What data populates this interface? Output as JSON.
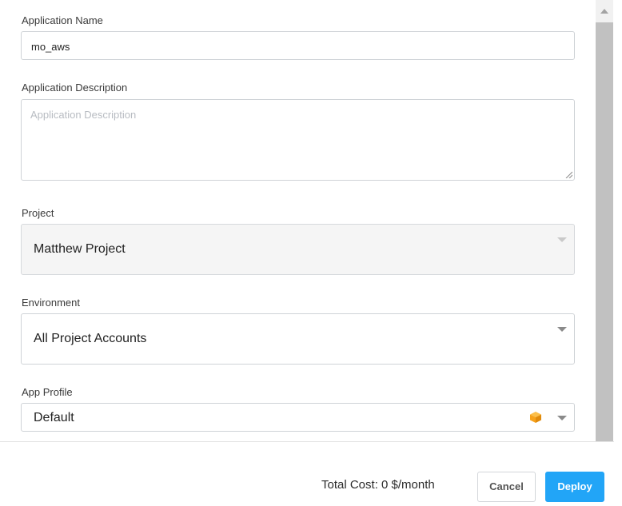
{
  "form": {
    "app_name_label": "Application Name",
    "app_name_value": "mo_aws",
    "app_desc_label": "Application Description",
    "app_desc_placeholder": "Application Description",
    "project_label": "Project",
    "project_value": "Matthew Project",
    "environment_label": "Environment",
    "environment_value": "All Project Accounts",
    "app_profile_label": "App Profile",
    "app_profile_value": "Default",
    "app_profile_icon": "aws-box-icon",
    "aws_icon_color": "#f7a21b"
  },
  "footer": {
    "total_cost": "Total Cost: 0 $/month",
    "cancel_label": "Cancel",
    "deploy_label": "Deploy",
    "deploy_color": "#22a5f7"
  }
}
